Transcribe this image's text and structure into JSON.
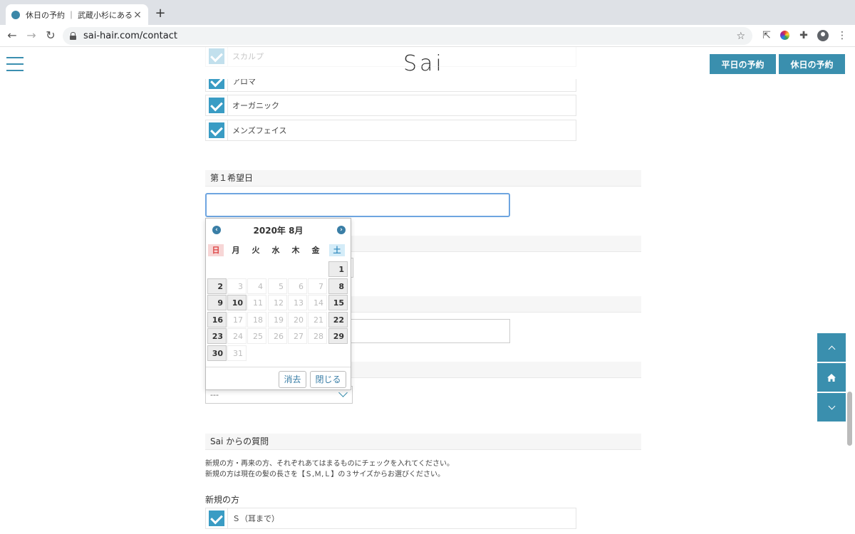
{
  "browser": {
    "tab_title": "休日の予約 ｜ 武蔵小杉にある美",
    "tab_close": "×",
    "new_tab": "+",
    "url": "sai-hair.com/contact"
  },
  "header": {
    "logo": "Sai",
    "weekday_button": "平日の予約",
    "holiday_button": "休日の予約"
  },
  "checkboxes": [
    {
      "label": "スカルプ"
    },
    {
      "label": "アロマ"
    },
    {
      "label": "オーガニック"
    },
    {
      "label": "メンズフェイス"
    }
  ],
  "form": {
    "first_date_label": "第１希望日",
    "select_value": "---"
  },
  "calendar": {
    "title": "2020年 8月",
    "dow": [
      "日",
      "月",
      "火",
      "水",
      "木",
      "金",
      "土"
    ],
    "clear_button": "消去",
    "close_button": "閉じる",
    "weeks": [
      [
        null,
        null,
        null,
        null,
        null,
        null,
        {
          "d": "1",
          "a": true
        }
      ],
      [
        {
          "d": "2",
          "a": true
        },
        {
          "d": "3",
          "a": false
        },
        {
          "d": "4",
          "a": false
        },
        {
          "d": "5",
          "a": false
        },
        {
          "d": "6",
          "a": false
        },
        {
          "d": "7",
          "a": false
        },
        {
          "d": "8",
          "a": true
        }
      ],
      [
        {
          "d": "9",
          "a": true
        },
        {
          "d": "10",
          "a": true
        },
        {
          "d": "11",
          "a": false
        },
        {
          "d": "12",
          "a": false
        },
        {
          "d": "13",
          "a": false
        },
        {
          "d": "14",
          "a": false
        },
        {
          "d": "15",
          "a": true
        }
      ],
      [
        {
          "d": "16",
          "a": true
        },
        {
          "d": "17",
          "a": false
        },
        {
          "d": "18",
          "a": false
        },
        {
          "d": "19",
          "a": false
        },
        {
          "d": "20",
          "a": false
        },
        {
          "d": "21",
          "a": false
        },
        {
          "d": "22",
          "a": true
        }
      ],
      [
        {
          "d": "23",
          "a": true
        },
        {
          "d": "24",
          "a": false
        },
        {
          "d": "25",
          "a": false
        },
        {
          "d": "26",
          "a": false
        },
        {
          "d": "27",
          "a": false
        },
        {
          "d": "28",
          "a": false
        },
        {
          "d": "29",
          "a": true
        }
      ],
      [
        {
          "d": "30",
          "a": true
        },
        {
          "d": "31",
          "a": false
        },
        null,
        null,
        null,
        null,
        null
      ]
    ]
  },
  "questions": {
    "title": "Sai からの質問",
    "desc1": "新規の方・再来の方、それぞれあてはまるものにチェックを入れてください。",
    "desc2": "新規の方は現在の髪の長さを【Ｓ,Ｍ,Ｌ】の３サイズからお選びください。",
    "new_customer": "新規の方",
    "size_s": "Ｓ（耳まで）"
  },
  "icons": {
    "back": "back-arrow-icon",
    "forward": "forward-arrow-icon",
    "reload": "reload-icon",
    "star": "star-icon",
    "extension": "puzzle-icon",
    "menu": "kebab-icon",
    "home": "home-icon"
  },
  "colors": {
    "accent": "#3a8fae",
    "checkbox": "#3a9cc4"
  }
}
